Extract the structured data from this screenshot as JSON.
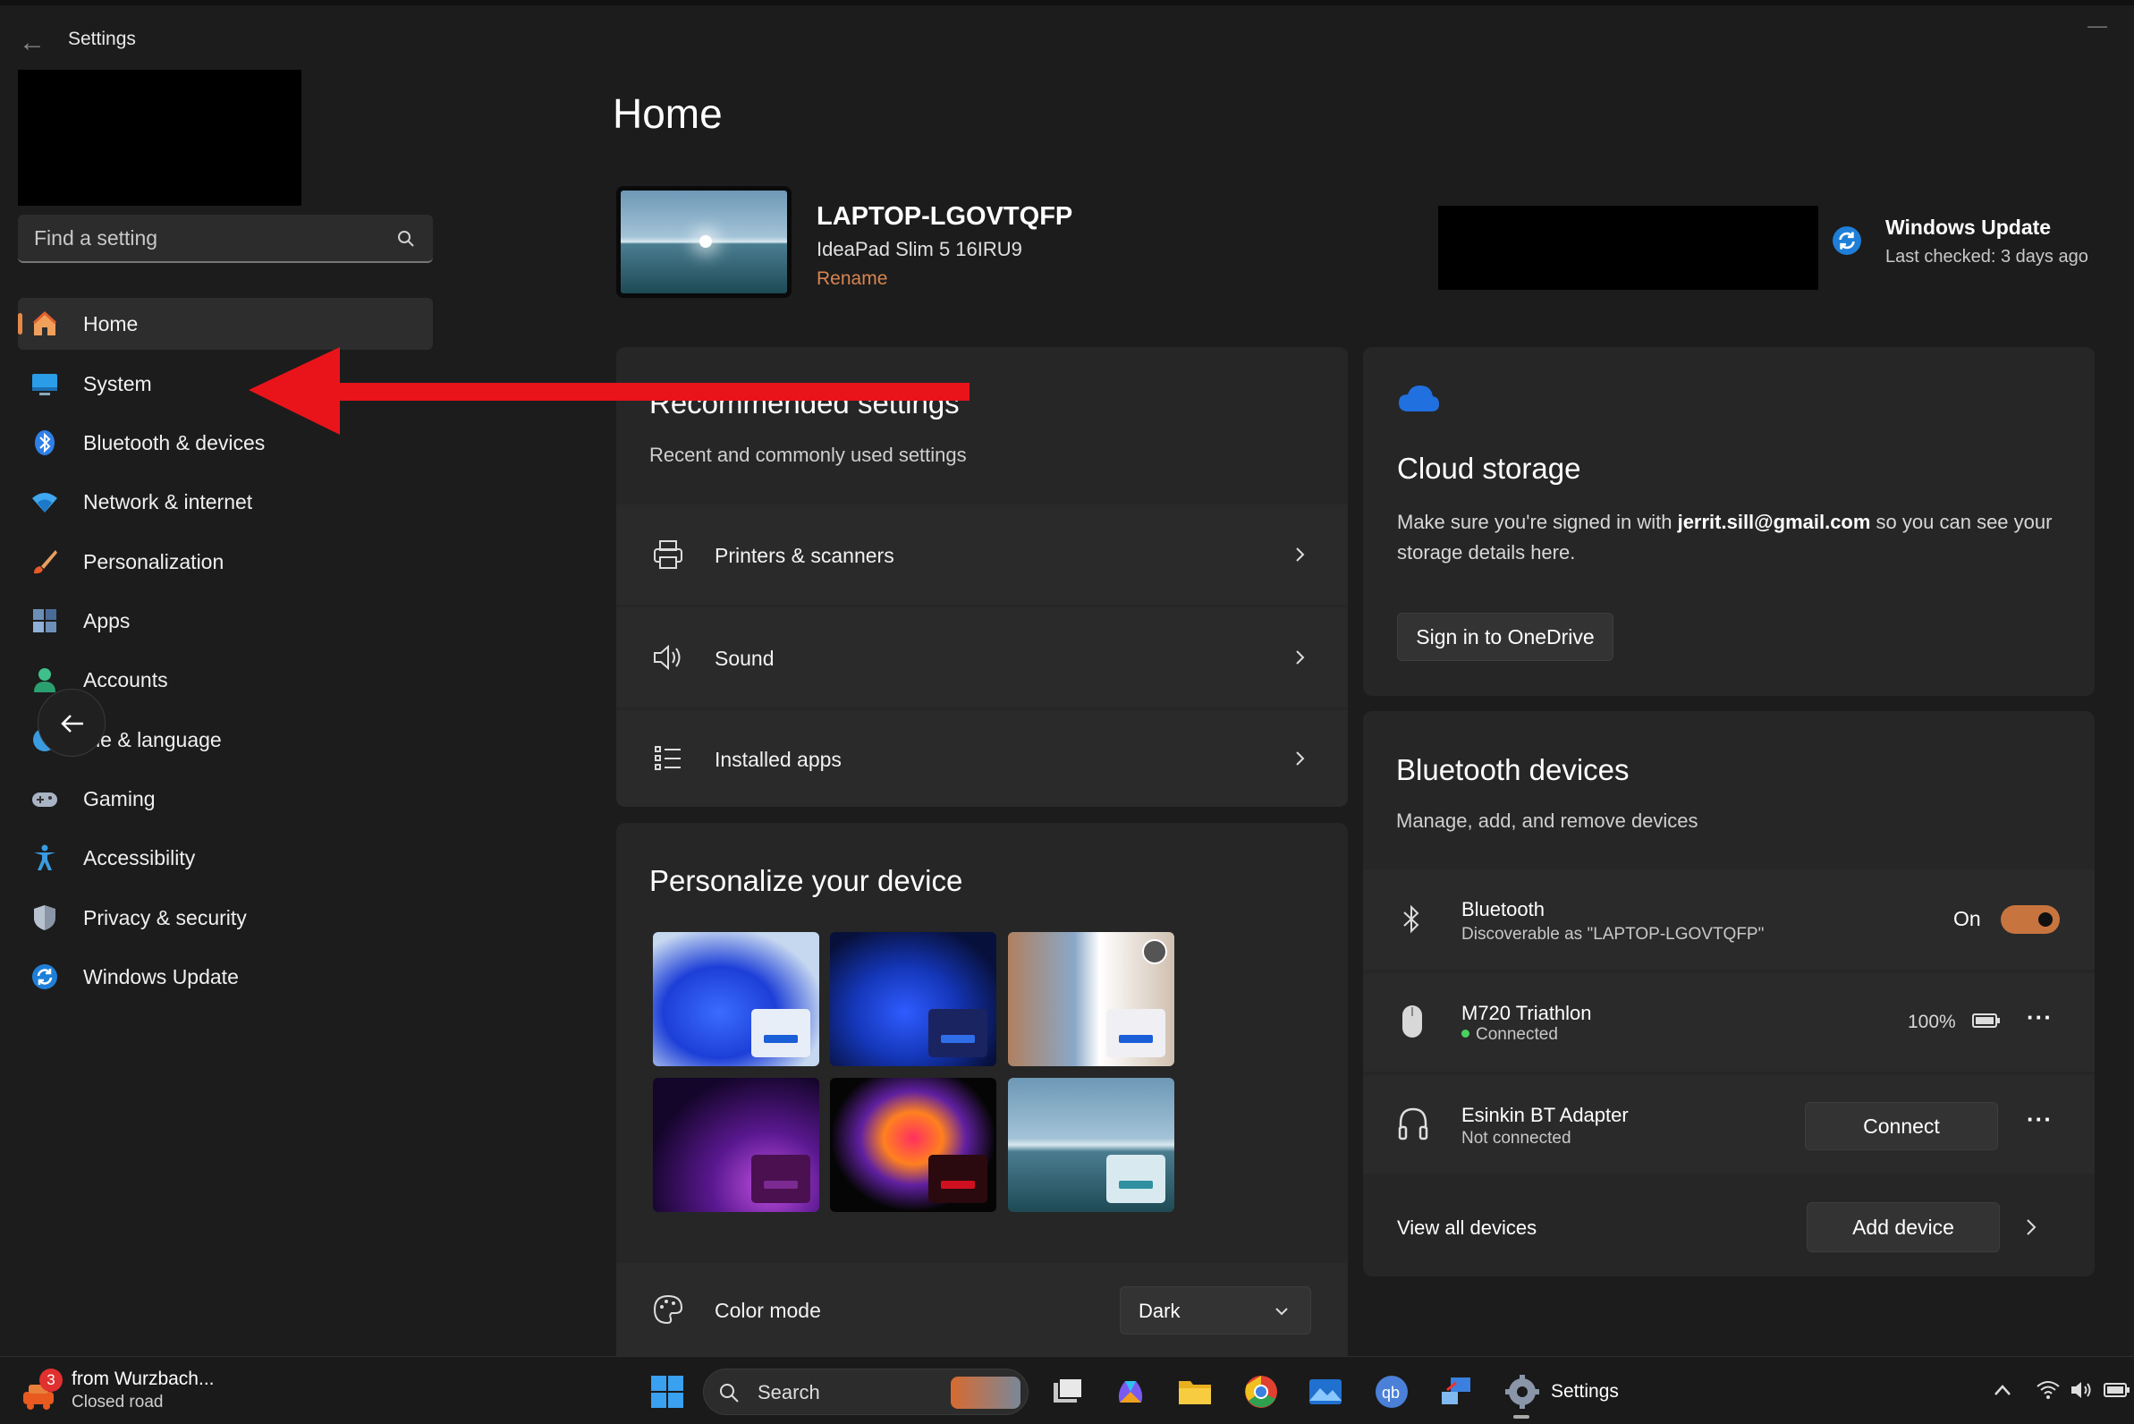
{
  "window": {
    "title": "Settings",
    "back_glyph": "←",
    "minimize_glyph": "—"
  },
  "search": {
    "placeholder": "Find a setting"
  },
  "sidebar": {
    "items": [
      {
        "label": "Home",
        "icon": "home-icon",
        "active": true
      },
      {
        "label": "System",
        "icon": "monitor-icon"
      },
      {
        "label": "Bluetooth & devices",
        "icon": "bluetooth-icon"
      },
      {
        "label": "Network & internet",
        "icon": "wifi-icon"
      },
      {
        "label": "Personalization",
        "icon": "brush-icon"
      },
      {
        "label": "Apps",
        "icon": "apps-icon"
      },
      {
        "label": "Accounts",
        "icon": "person-icon"
      },
      {
        "label": "me & language",
        "icon": "globe-clock-icon"
      },
      {
        "label": "Gaming",
        "icon": "gamepad-icon"
      },
      {
        "label": "Accessibility",
        "icon": "accessibility-icon"
      },
      {
        "label": "Privacy & security",
        "icon": "shield-icon"
      },
      {
        "label": "Windows Update",
        "icon": "update-icon"
      }
    ]
  },
  "main": {
    "title": "Home",
    "device": {
      "name": "LAPTOP-LGOVTQFP",
      "model": "IdeaPad Slim 5 16IRU9",
      "rename": "Rename"
    },
    "windows_update": {
      "title": "Windows Update",
      "subtitle": "Last checked: 3 days ago"
    },
    "recommended": {
      "title": "Recommended settings",
      "subtitle": "Recent and commonly used settings",
      "items": [
        {
          "label": "Printers & scanners",
          "icon": "printer-icon"
        },
        {
          "label": "Sound",
          "icon": "speaker-icon"
        },
        {
          "label": "Installed apps",
          "icon": "list-icon"
        }
      ]
    },
    "personalize": {
      "title": "Personalize your device",
      "color_mode_label": "Color mode",
      "color_mode_value": "Dark"
    },
    "cloud": {
      "title": "Cloud storage",
      "text_before": "Make sure you're signed in with ",
      "email": "jerrit.sill@gmail.com",
      "text_after": " so you can see your storage details here.",
      "button": "Sign in to OneDrive"
    },
    "bluetooth": {
      "title": "Bluetooth devices",
      "subtitle": "Manage, add, and remove devices",
      "bt_label": "Bluetooth",
      "bt_sub": "Discoverable as \"LAPTOP-LGOVTQFP\"",
      "bt_state": "On",
      "devices": [
        {
          "name": "M720 Triathlon",
          "status": "Connected",
          "battery": "100%",
          "icon": "mouse-icon"
        },
        {
          "name": "Esinkin BT Adapter",
          "status": "Not connected",
          "button": "Connect",
          "icon": "headphones-icon"
        }
      ],
      "view_all": "View all devices",
      "add_device": "Add device",
      "more_glyph": "···"
    }
  },
  "taskbar": {
    "weather_title": "from Wurzbach...",
    "weather_sub": "Closed road",
    "badge": "3",
    "search_label": "Search",
    "settings_label": "Settings"
  },
  "colors": {
    "accent": "#e4884a",
    "bg": "#1c1c1c",
    "card": "#262626",
    "arrow": "#e8141a"
  }
}
